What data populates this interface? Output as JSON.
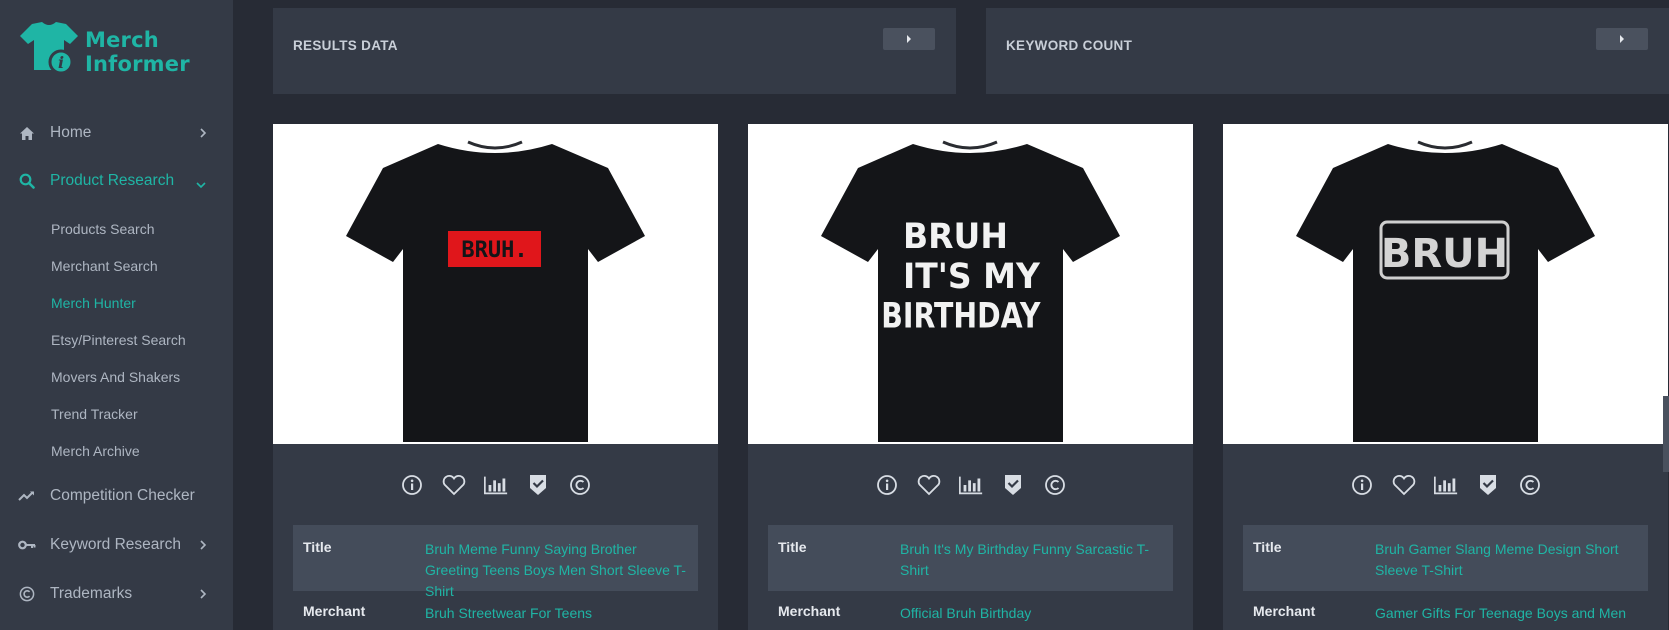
{
  "brand": {
    "line1": "Merch",
    "line2": "Informer",
    "icon": "tshirt-info-icon",
    "color": "#1fb5a5"
  },
  "sidebar": {
    "items": [
      {
        "label": "Home",
        "icon": "home-icon",
        "has_chevron": true,
        "expanded": false
      },
      {
        "label": "Product Research",
        "icon": "search-icon",
        "has_chevron": true,
        "expanded": true
      },
      {
        "label": "Competition Checker",
        "icon": "trend-icon",
        "has_chevron": false,
        "expanded": false
      },
      {
        "label": "Keyword Research",
        "icon": "key-icon",
        "has_chevron": true,
        "expanded": false
      },
      {
        "label": "Trademarks",
        "icon": "copyright-icon",
        "has_chevron": true,
        "expanded": false
      }
    ],
    "sub_items": [
      {
        "label": "Products Search",
        "active": false
      },
      {
        "label": "Merchant Search",
        "active": false
      },
      {
        "label": "Merch Hunter",
        "active": true
      },
      {
        "label": "Etsy/Pinterest Search",
        "active": false
      },
      {
        "label": "Movers And Shakers",
        "active": false
      },
      {
        "label": "Trend Tracker",
        "active": false
      },
      {
        "label": "Merch Archive",
        "active": false
      }
    ]
  },
  "panels": [
    {
      "title": "RESULTS DATA"
    },
    {
      "title": "KEYWORD COUNT"
    }
  ],
  "labels": {
    "title": "Title",
    "merchant": "Merchant"
  },
  "products": [
    {
      "design_text": "BRUH.",
      "title": "Bruh Meme Funny Saying Brother Greeting Teens Boys Men Short Sleeve T-Shirt",
      "merchant": "Bruh Streetwear For Teens"
    },
    {
      "design_text": "BRUH IT'S MY BIRTHDAY",
      "title": "Bruh It's My Birthday Funny Sarcastic T-Shirt",
      "merchant": "Official Bruh Birthday"
    },
    {
      "design_text": "BRUH",
      "title": "Bruh Gamer Slang Meme Design Short Sleeve T-Shirt",
      "merchant": "Gamer Gifts For Teenage Boys and Men"
    }
  ],
  "card_icons": [
    "info-icon",
    "heart-icon",
    "bar-chart-icon",
    "shield-check-icon",
    "copyright-icon"
  ],
  "colors": {
    "accent": "#1fb5a5",
    "sidebar_bg": "#343a46",
    "page_bg": "#272b35"
  }
}
